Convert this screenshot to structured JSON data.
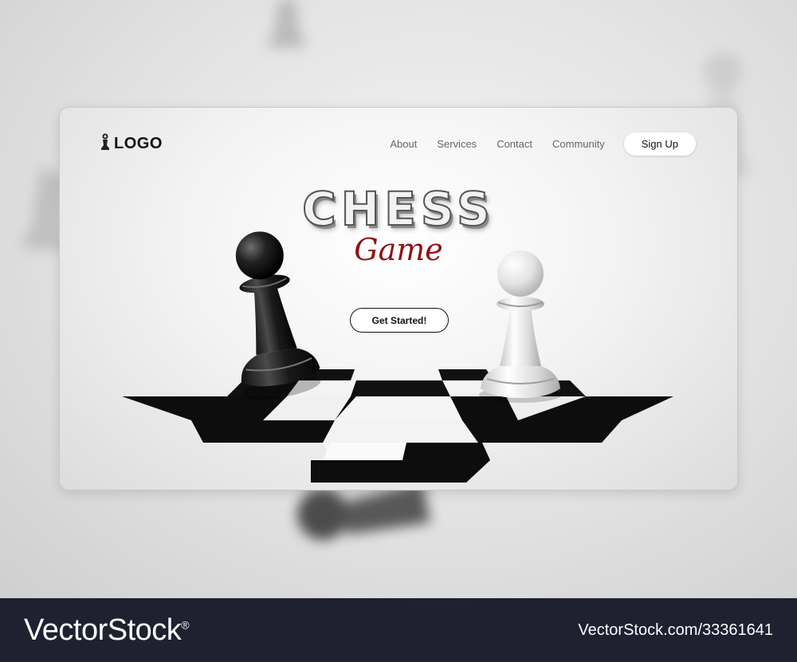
{
  "brand": {
    "logo_text": "LOGO"
  },
  "nav": {
    "links": [
      "About",
      "Services",
      "Contact",
      "Community"
    ],
    "signup_label": "Sign Up"
  },
  "hero": {
    "title": "CHESS",
    "subtitle": "Game",
    "cta_label": "Get Started!"
  },
  "colors": {
    "accent_red": "#8e1216",
    "footer_bg": "#1f2130",
    "board_dark": "#0d0d0d",
    "board_light": "#f5f5f5"
  },
  "icons": {
    "logo": "pawn-icon"
  },
  "watermark": {
    "brand": "VectorStock",
    "trademark": "®",
    "reference": "VectorStock.com/33361641"
  }
}
